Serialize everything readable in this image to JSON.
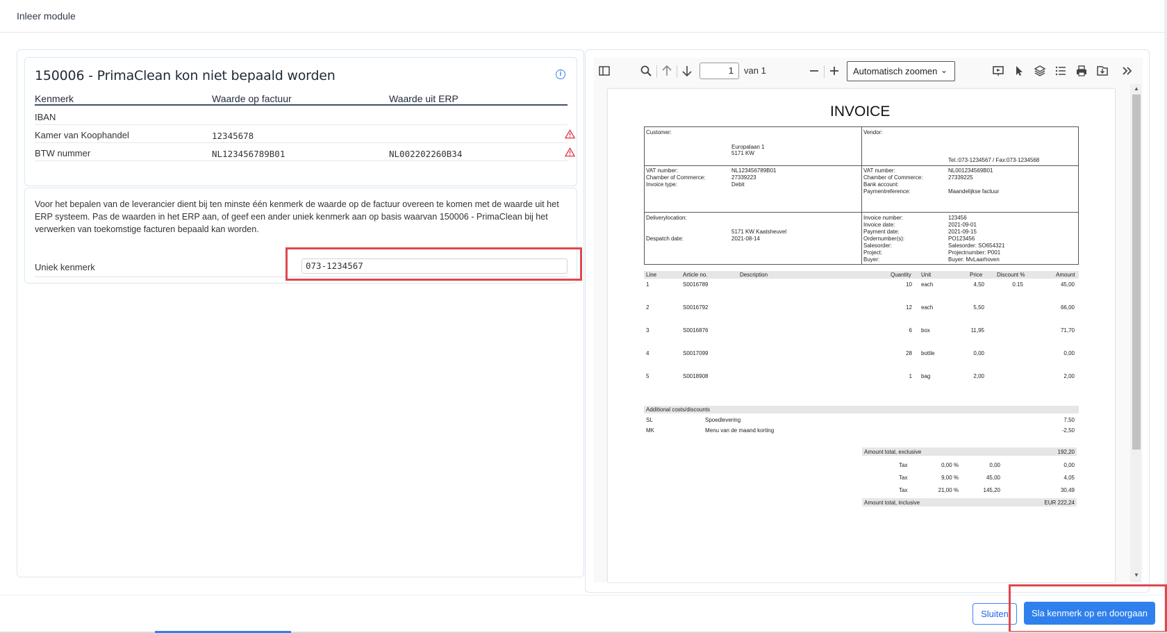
{
  "module_title": "Inleer module",
  "match_card": {
    "title": "150006 - PrimaClean kon niet bepaald worden",
    "columns": [
      "Kenmerk",
      "Waarde op factuur",
      "Waarde uit ERP"
    ],
    "rows": [
      {
        "kenmerk": "IBAN",
        "factuur": "",
        "erp": "",
        "warning": false
      },
      {
        "kenmerk": "Kamer van Koophandel",
        "factuur": "12345678",
        "erp": "",
        "warning": true
      },
      {
        "kenmerk": "BTW nummer",
        "factuur": "NL123456789B01",
        "erp": "NL002202260B34",
        "warning": true
      }
    ]
  },
  "explanation": "Voor het bepalen van de leverancier dient bij ten minste één kenmerk de waarde op de factuur overeen te komen met de waarde uit het ERP systeem. Pas de waarden in het ERP aan, of geef een ander uniek kenmerk aan op basis waarvan 150006 - PrimaClean bij het verwerken van toekomstige facturen bepaald kan worden.",
  "unique_field": {
    "label": "Uniek kenmerk",
    "value": "073-1234567"
  },
  "pdf_viewer": {
    "page_number": "1",
    "page_of": "van 1",
    "zoom": "Automatisch zoomen"
  },
  "invoice": {
    "title": "INVOICE",
    "customer_label": "Customer:",
    "customer_address": [
      "Europalaan 1",
      "5171 KW"
    ],
    "vendor_label": "Vendor:",
    "vendor_contact": "Tel.:073-1234567 / Fax:073-1234568",
    "left_info": [
      {
        "label": "VAT number:",
        "value": "NL123456789B01"
      },
      {
        "label": "Chamber of Commerce:",
        "value": "27339223"
      },
      {
        "label": "Invoice type:",
        "value": "Debit"
      }
    ],
    "right_info": [
      {
        "label": "VAT number:",
        "value": "NL001234569B01"
      },
      {
        "label": "Chamber of Commerce:",
        "value": "27339225"
      },
      {
        "label": "Bank account:",
        "value": ""
      },
      {
        "label": "Paymentreference:",
        "value": "Maandelijkse factuur"
      }
    ],
    "delivery_label": "Deliverylocation:",
    "delivery_address": "5171 KW Kaatsheuvel",
    "despatch_label": "Despatch date:",
    "despatch_date": "2021-08-14",
    "order_info": [
      {
        "label": "Invoice number:",
        "value": "123456"
      },
      {
        "label": "Invoice date:",
        "value": "2021-09-01"
      },
      {
        "label": "Payment date:",
        "value": "2021-09-15"
      },
      {
        "label": "Ordernumber(s):",
        "value": "PO123456"
      },
      {
        "label": "Salesorder:",
        "value": "Salesorder: SO654321"
      },
      {
        "label": "Project:",
        "value": "Projectnumber: P001"
      },
      {
        "label": "Buyer:",
        "value": "Buyer: MvLaarhoven"
      }
    ],
    "line_headers": [
      "Line",
      "Article no.",
      "Description",
      "Quantity",
      "Unit",
      "Price",
      "Discount %",
      "Amount"
    ],
    "lines": [
      {
        "line": "1",
        "article": "S0016789",
        "qty": "10",
        "unit": "each",
        "price": "4,50",
        "discount": "0.15",
        "amount": "45,00"
      },
      {
        "line": "2",
        "article": "S0016792",
        "qty": "12",
        "unit": "each",
        "price": "5,50",
        "discount": "",
        "amount": "66,00"
      },
      {
        "line": "3",
        "article": "S0016876",
        "qty": "6",
        "unit": "box",
        "price": "11,95",
        "discount": "",
        "amount": "71,70"
      },
      {
        "line": "4",
        "article": "S0017099",
        "qty": "28",
        "unit": "bottle",
        "price": "0,00",
        "discount": "",
        "amount": "0,00"
      },
      {
        "line": "5",
        "article": "S0018908",
        "qty": "1",
        "unit": "bag",
        "price": "2,00",
        "discount": "",
        "amount": "2,00"
      }
    ],
    "additional_header": "Additional costs/discounts",
    "additional": [
      {
        "code": "SL",
        "desc": "Spoedlevering",
        "amount": "7,50"
      },
      {
        "code": "MK",
        "desc": "Menu van de maand korting",
        "amount": "-2,50"
      }
    ],
    "total_excl_label": "Amount total, exclusive",
    "total_excl": "192,20",
    "taxes": [
      {
        "label": "Tax",
        "rate": "0,00 %",
        "base": "0,00",
        "amount": "0,00"
      },
      {
        "label": "Tax",
        "rate": "9,00 %",
        "base": "45,00",
        "amount": "4,05"
      },
      {
        "label": "Tax",
        "rate": "21,00 %",
        "base": "145,20",
        "amount": "30,49"
      }
    ],
    "total_incl_label": "Amount total, inclusive",
    "total_incl": "EUR 222,24"
  },
  "buttons": {
    "close": "Sluiten",
    "save": "Sla kenmerk op en doorgaan"
  },
  "colors": {
    "primary": "#2f80ed",
    "warning": "#dc3545",
    "highlight": "#e0474c"
  }
}
